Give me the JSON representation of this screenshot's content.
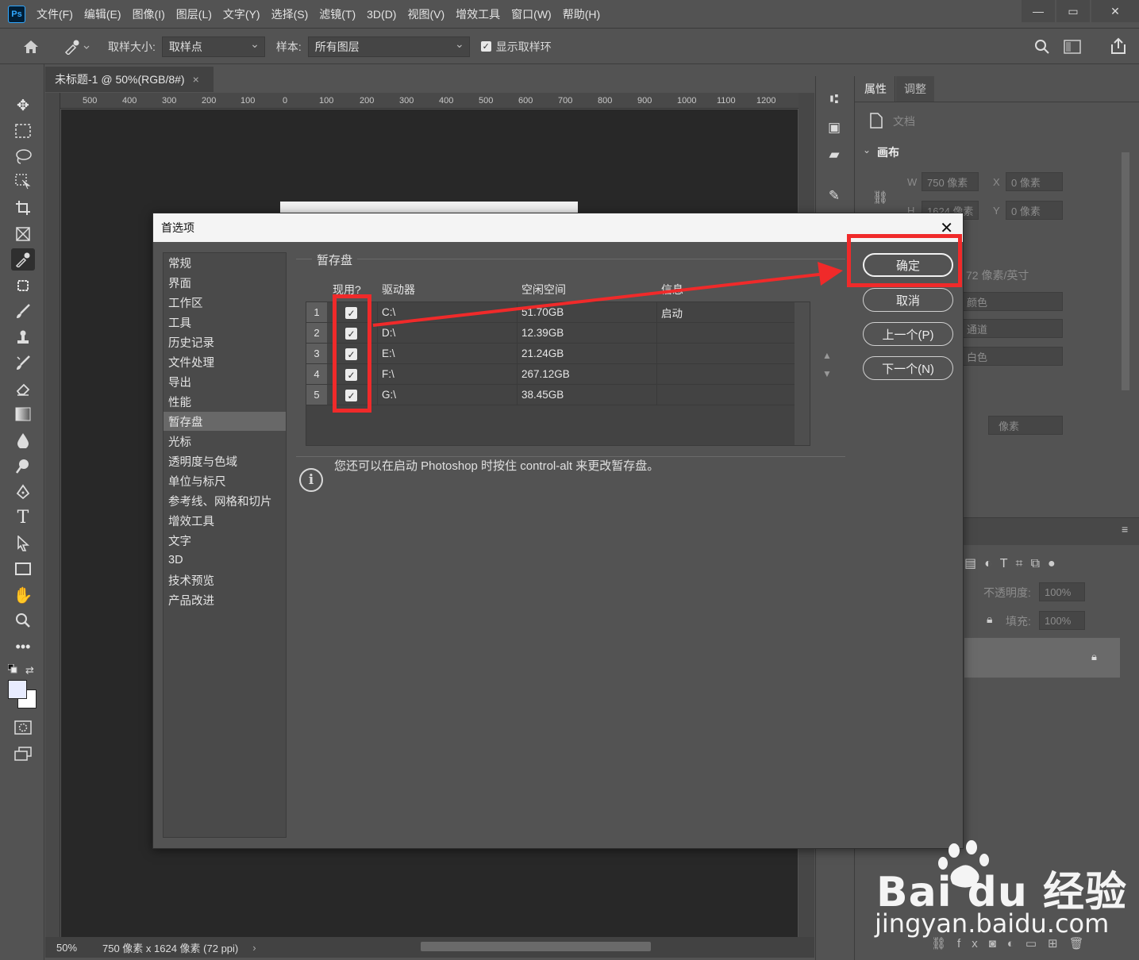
{
  "app": {
    "logo": "Ps",
    "menu": [
      "文件(F)",
      "编辑(E)",
      "图像(I)",
      "图层(L)",
      "文字(Y)",
      "选择(S)",
      "滤镜(T)",
      "3D(D)",
      "视图(V)",
      "增效工具",
      "窗口(W)",
      "帮助(H)"
    ],
    "window_controls": [
      "—",
      "▭",
      "✕"
    ]
  },
  "options": {
    "sample_size_label": "取样大小:",
    "sample_size_value": "取样点",
    "sample_label": "样本:",
    "sample_value": "所有图层",
    "show_ring_label": "显示取样环"
  },
  "document": {
    "tab_title": "未标题-1 @ 50%(RGB/8#)",
    "tab_close": "×",
    "ruler_ticks": [
      "500",
      "400",
      "300",
      "200",
      "100",
      "0",
      "100",
      "200",
      "300",
      "400",
      "500",
      "600",
      "700",
      "800",
      "900",
      "1000",
      "1100",
      "1200"
    ],
    "zoom": "50%",
    "doc_info": "750 像素 x 1624 像素 (72 ppi)"
  },
  "panel": {
    "tabs": [
      "属性",
      "调整"
    ],
    "doc_label": "文档",
    "canvas_section": "画布",
    "w_label": "W",
    "w_value": "750 像素",
    "h_label": "H",
    "h_value": "1624 像素",
    "x_label": "X",
    "x_value": "0 像素",
    "y_label": "Y",
    "y_value": "0 像素",
    "resolution": "72 像素/英寸",
    "mode_partial": "颜色",
    "depth_partial": "通道",
    "bg_partial": "白色",
    "unit": "像素",
    "opacity_label": "不透明度:",
    "opacity_value": "100%",
    "fill_label": "填充:",
    "fill_value": "100%"
  },
  "dialog": {
    "title": "首选项",
    "close": "✕",
    "nav": [
      "常规",
      "界面",
      "工作区",
      "工具",
      "历史记录",
      "文件处理",
      "导出",
      "性能",
      "暂存盘",
      "光标",
      "透明度与色域",
      "单位与标尺",
      "参考线、网格和切片",
      "增效工具",
      "文字",
      "3D",
      "技术预览",
      "产品改进"
    ],
    "active_nav": "暂存盘",
    "section": "暂存盘",
    "columns": [
      "现用?",
      "驱动器",
      "空闲空间",
      "信息"
    ],
    "rows": [
      {
        "num": "1",
        "checked": true,
        "drive": "C:\\",
        "free": "51.70GB",
        "info": "启动"
      },
      {
        "num": "2",
        "checked": true,
        "drive": "D:\\",
        "free": "12.39GB",
        "info": ""
      },
      {
        "num": "3",
        "checked": true,
        "drive": "E:\\",
        "free": "21.24GB",
        "info": ""
      },
      {
        "num": "4",
        "checked": true,
        "drive": "F:\\",
        "free": "267.12GB",
        "info": ""
      },
      {
        "num": "5",
        "checked": true,
        "drive": "G:\\",
        "free": "38.45GB",
        "info": ""
      }
    ],
    "info_icon": "i",
    "info_text": "您还可以在启动 Photoshop 时按住 control-alt 来更改暂存盘。",
    "buttons": {
      "ok": "确定",
      "cancel": "取消",
      "prev": "上一个(P)",
      "next": "下一个(N)"
    }
  },
  "watermark": {
    "brand": "Bai du 经验",
    "url": "jingyan.baidu.com"
  },
  "colors": {
    "annotation_red": "#f02a2a",
    "ui_bg": "#535353",
    "canvas_bg": "#282828",
    "ps_blue": "#31a8ff"
  }
}
